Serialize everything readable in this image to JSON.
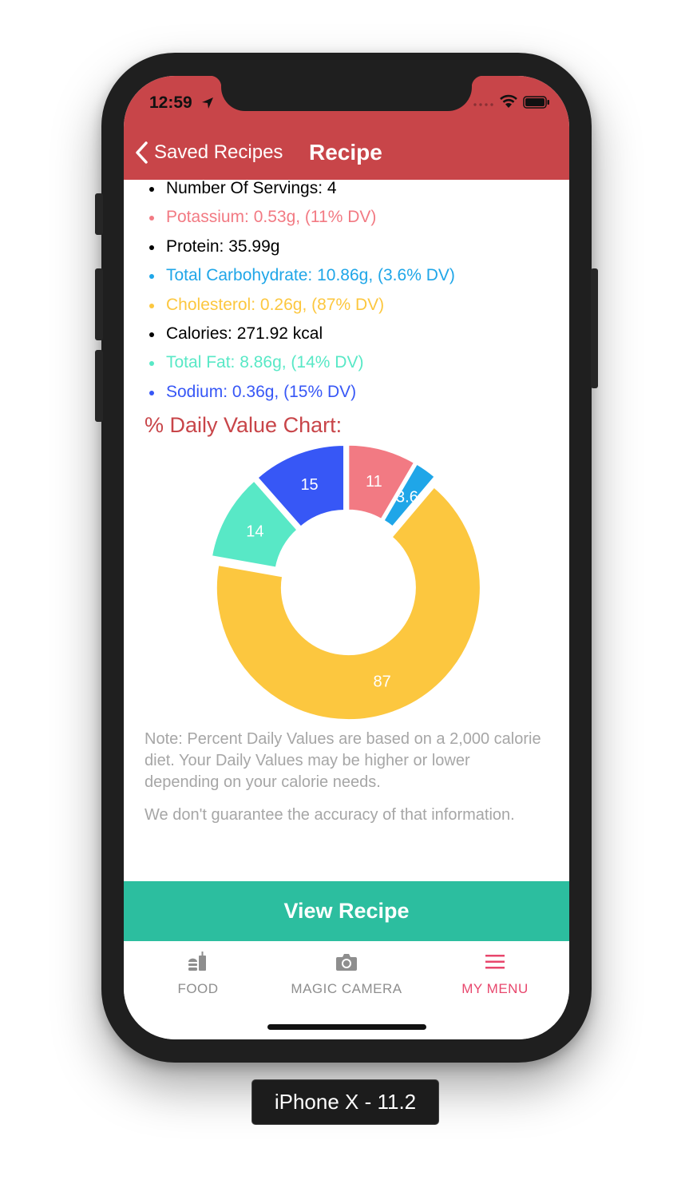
{
  "status_bar": {
    "time": "12:59"
  },
  "nav": {
    "back_label": "Saved Recipes",
    "title": "Recipe"
  },
  "nutrients": [
    {
      "text": "Number Of Servings: 4",
      "color": "#000000"
    },
    {
      "text": "Potassium: 0.53g, (11% DV)",
      "color": "#f27a83"
    },
    {
      "text": "Protein: 35.99g",
      "color": "#000000"
    },
    {
      "text": "Total Carbohydrate: 10.86g, (3.6% DV)",
      "color": "#1fa6e8"
    },
    {
      "text": "Cholesterol: 0.26g, (87% DV)",
      "color": "#fcc73f"
    },
    {
      "text": "Calories: 271.92 kcal",
      "color": "#000000"
    },
    {
      "text": "Total Fat: 8.86g, (14% DV)",
      "color": "#58e8c6"
    },
    {
      "text": "Sodium: 0.36g, (15% DV)",
      "color": "#3757f6"
    }
  ],
  "chart_title": "% Daily Value Chart:",
  "chart_data": {
    "type": "pie",
    "donut": true,
    "slices": [
      {
        "label": "11",
        "value": 11,
        "color": "#f27a83"
      },
      {
        "label": "3.6",
        "value": 3.6,
        "color": "#1fa6e8"
      },
      {
        "label": "87",
        "value": 87,
        "color": "#fcc73f"
      },
      {
        "label": "14",
        "value": 14,
        "color": "#58e8c6"
      },
      {
        "label": "15",
        "value": 15,
        "color": "#3757f6"
      }
    ]
  },
  "note": "Note: Percent Daily Values are based on a 2,000 calorie diet. Your Daily Values may be higher or lower depending on your calorie needs.",
  "disclaimer": "We don't guarantee the accuracy of that information.",
  "view_recipe_label": "View Recipe",
  "tabs": [
    {
      "label": "FOOD",
      "icon": "food-icon",
      "active": false,
      "color": "#8e8e8e"
    },
    {
      "label": "MAGIC CAMERA",
      "icon": "camera-icon",
      "active": false,
      "color": "#8e8e8e"
    },
    {
      "label": "MY MENU",
      "icon": "menu-icon",
      "active": true,
      "color": "#e8476d"
    }
  ],
  "device_label": "iPhone X - 11.2",
  "colors": {
    "header": "#c84549",
    "accent_button": "#2cbe9f",
    "note_text": "#a6a6a6"
  }
}
